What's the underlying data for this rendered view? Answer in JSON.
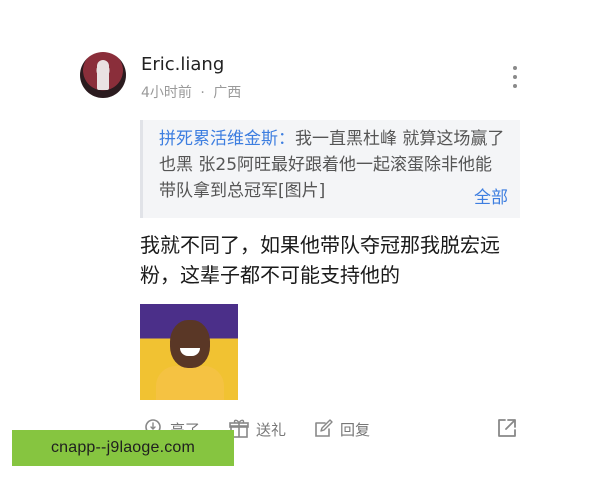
{
  "comment": {
    "username": "Eric.liang",
    "time_ago": "4小时前",
    "separator": "·",
    "location": "广西",
    "quote": {
      "author": "拼死累活维金斯：",
      "text": "我一直黑杜峰 就算这场赢了也黑 张25阿旺最好跟着他一起滚蛋除非他能带队拿到总冠军[图片]",
      "expand_label": "全部"
    },
    "body": "我就不同了，如果他带队夺冠那我脱宏远粉，这辈子都不可能支持他的",
    "actions": {
      "like_label": "亮了",
      "gift_label": "送礼",
      "reply_label": "回复"
    }
  },
  "watermark": {
    "text": "cnapp--j9laoge.com"
  },
  "colors": {
    "accent": "#3d7ee0",
    "meta_gray": "#9a9a9a",
    "quote_bg": "#f4f5f7",
    "watermark_bg": "#86c540"
  }
}
